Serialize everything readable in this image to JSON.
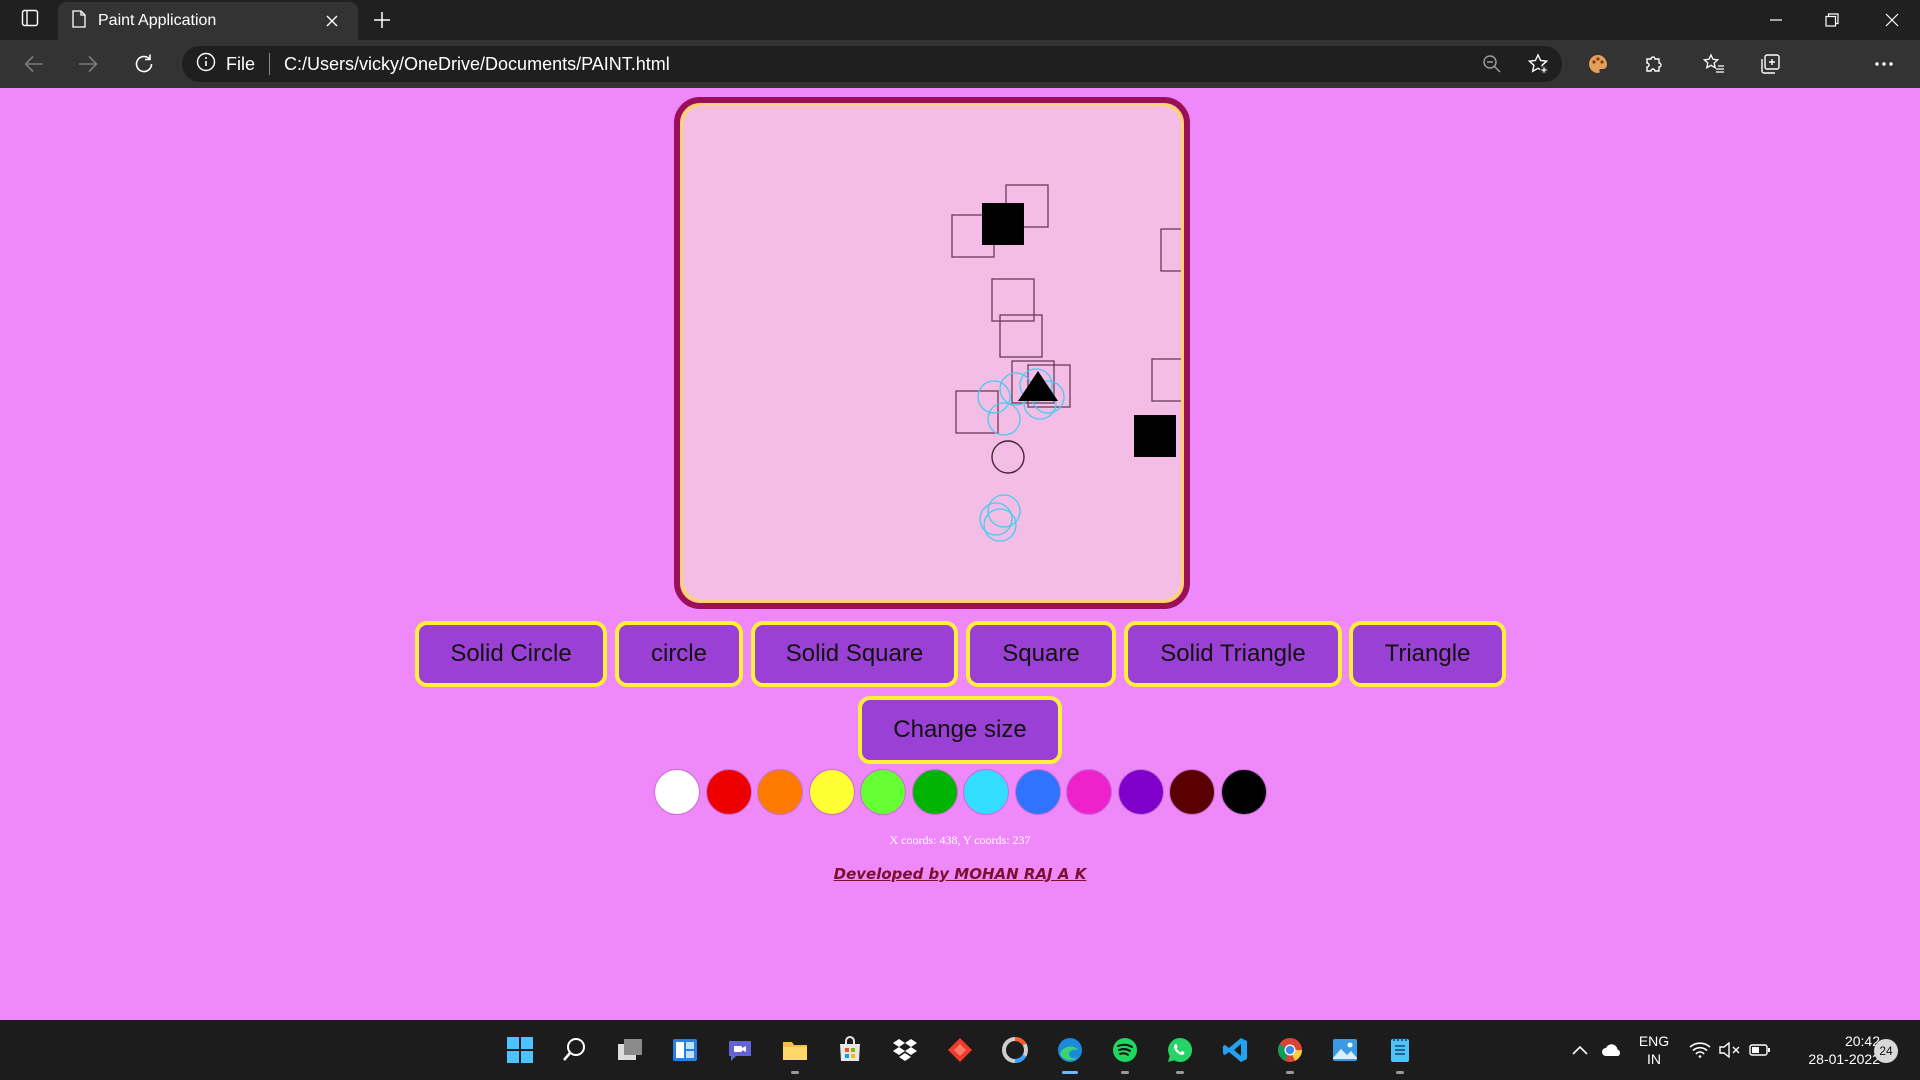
{
  "browser": {
    "tab_title": "Paint Application",
    "address_scheme": "File",
    "address_url": "C:/Users/vicky/OneDrive/Documents/PAINT.html",
    "icons": {
      "tab_actions": "tab-actions-icon",
      "page": "document-icon",
      "close_tab": "close-icon",
      "new_tab": "plus-icon",
      "back": "arrow-left-icon",
      "forward": "arrow-right-icon",
      "refresh": "refresh-icon",
      "info": "info-icon",
      "zoom": "zoom-out-icon",
      "favorite": "add-favorite-icon",
      "extension_palette": "palette-icon",
      "extensions": "puzzle-icon",
      "favorites": "favorites-icon",
      "collections": "collections-icon",
      "more": "ellipsis-icon"
    }
  },
  "app": {
    "shape_buttons": [
      {
        "label": "Solid Circle"
      },
      {
        "label": "circle"
      },
      {
        "label": "Solid Square"
      },
      {
        "label": "Square"
      },
      {
        "label": "Solid Triangle"
      },
      {
        "label": "Triangle"
      }
    ],
    "size_button": "Change size",
    "palette": [
      "#ffffff",
      "#ee0000",
      "#ff7a00",
      "#ffff33",
      "#66ff33",
      "#00b300",
      "#33ddff",
      "#2f73ff",
      "#ee22cc",
      "#8000cc",
      "#5a0000",
      "#000000"
    ],
    "coords_text": "X coords: 438, Y coords: 237",
    "credit": "Developed by MOHAN RAJ A K",
    "colors": {
      "page_bg": "#ef88f9",
      "canvas_bg": "#f4bde6",
      "canvas_border": "#9a0e5a",
      "button_bg": "#9b40d4",
      "button_border": "#fff03a"
    }
  },
  "taskbar": {
    "apps": [
      "windows-start-icon",
      "search-icon",
      "task-view-icon",
      "widgets-icon",
      "teams-chat-icon",
      "file-explorer-icon",
      "microsoft-store-icon",
      "dropbox-icon",
      "anydesk-icon",
      "davinci-icon",
      "edge-icon",
      "spotify-icon",
      "whatsapp-icon",
      "vscode-icon",
      "chrome-icon",
      "photos-icon",
      "notepad-icon"
    ],
    "language_line1": "ENG",
    "language_line2": "IN",
    "time": "20:42",
    "date": "28-01-2022",
    "notifications": "24"
  }
}
